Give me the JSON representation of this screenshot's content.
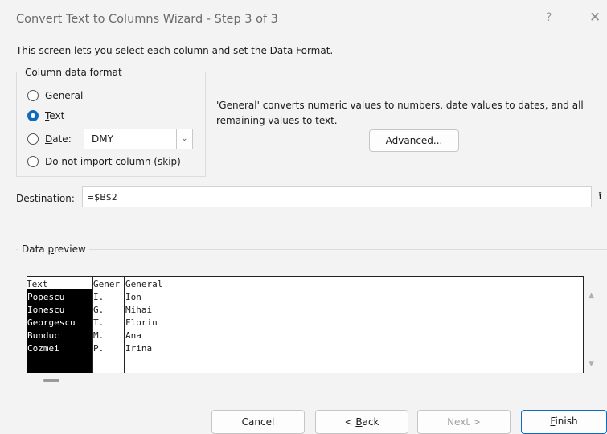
{
  "dialog": {
    "title": "Convert Text to Columns Wizard - Step 3 of 3",
    "help": "?",
    "close": "✕",
    "intro": "This screen lets you select each column and set the Data Format."
  },
  "format": {
    "legend": "Column data format",
    "options": [
      {
        "pre": "",
        "u": "G",
        "post": "eneral",
        "checked": false
      },
      {
        "pre": "",
        "u": "T",
        "post": "ext",
        "checked": true
      },
      {
        "pre": "",
        "u": "D",
        "post": "ate:",
        "checked": false
      },
      {
        "pre": "Do not ",
        "u": "i",
        "post": "mport column (skip)",
        "checked": false
      }
    ],
    "date_value": "DMY",
    "description": "'General' converts numeric values to numbers, date values to dates, and all remaining values to text.",
    "advanced_pre": "",
    "advanced_u": "A",
    "advanced_post": "dvanced..."
  },
  "destination": {
    "label_pre": "D",
    "label_u": "e",
    "label_post": "stination:",
    "value": "=$B$2",
    "collapse_icon": "⭱"
  },
  "preview": {
    "legend_pre": "Data ",
    "legend_u": "p",
    "legend_post": "review",
    "columns": [
      {
        "header": "Text",
        "cells": [
          "Popescu",
          "Ionescu",
          "Georgescu",
          "Bunduc",
          "Cozmei"
        ]
      },
      {
        "header": "Gener",
        "cells": [
          "I.",
          "G.",
          "T.",
          "M.",
          "P."
        ]
      },
      {
        "header": "General",
        "cells": [
          "Ion",
          "Mihai",
          "Florin",
          "Ana",
          "Irina"
        ]
      }
    ]
  },
  "buttons": {
    "cancel": "Cancel",
    "back_pre": "< ",
    "back_u": "B",
    "back_post": "ack",
    "next": "Next >",
    "finish_u": "F",
    "finish_post": "inish"
  }
}
